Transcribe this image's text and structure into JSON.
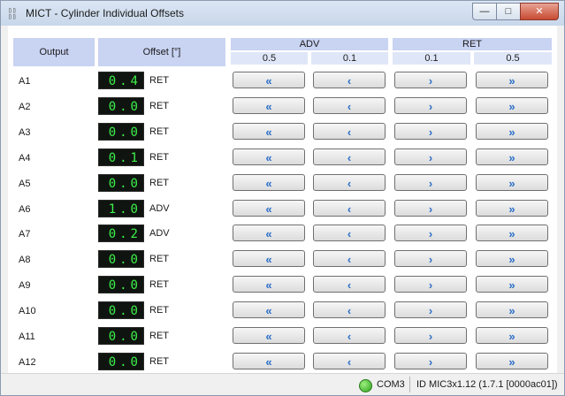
{
  "window": {
    "title": "MICT - Cylinder Individual Offsets",
    "app_icon_text": "MICT",
    "controls": {
      "minimize": "—",
      "maximize": "□",
      "close": "✕"
    }
  },
  "table": {
    "headers": {
      "output": "Output",
      "offset": "Offset [°]",
      "adv": "ADV",
      "ret": "RET"
    },
    "steps": {
      "adv_05": "0.5",
      "adv_01": "0.1",
      "ret_01": "0.1",
      "ret_05": "0.5"
    },
    "button_glyphs": {
      "adv_05": "«",
      "adv_01": "‹",
      "ret_01": "›",
      "ret_05": "»"
    },
    "rows": [
      {
        "label": "A1",
        "offset": "0.4",
        "dir": "RET"
      },
      {
        "label": "A2",
        "offset": "0.0",
        "dir": "RET"
      },
      {
        "label": "A3",
        "offset": "0.0",
        "dir": "RET"
      },
      {
        "label": "A4",
        "offset": "0.1",
        "dir": "RET"
      },
      {
        "label": "A5",
        "offset": "0.0",
        "dir": "RET"
      },
      {
        "label": "A6",
        "offset": "1.0",
        "dir": "ADV"
      },
      {
        "label": "A7",
        "offset": "0.2",
        "dir": "ADV"
      },
      {
        "label": "A8",
        "offset": "0.0",
        "dir": "RET"
      },
      {
        "label": "A9",
        "offset": "0.0",
        "dir": "RET"
      },
      {
        "label": "A10",
        "offset": "0.0",
        "dir": "RET"
      },
      {
        "label": "A11",
        "offset": "0.0",
        "dir": "RET"
      },
      {
        "label": "A12",
        "offset": "0.0",
        "dir": "RET"
      }
    ]
  },
  "status": {
    "port": "COM3",
    "id": "ID MIC3x1.12 (1.7.1 [0000ac01])",
    "led_color": "#2ea11c"
  }
}
